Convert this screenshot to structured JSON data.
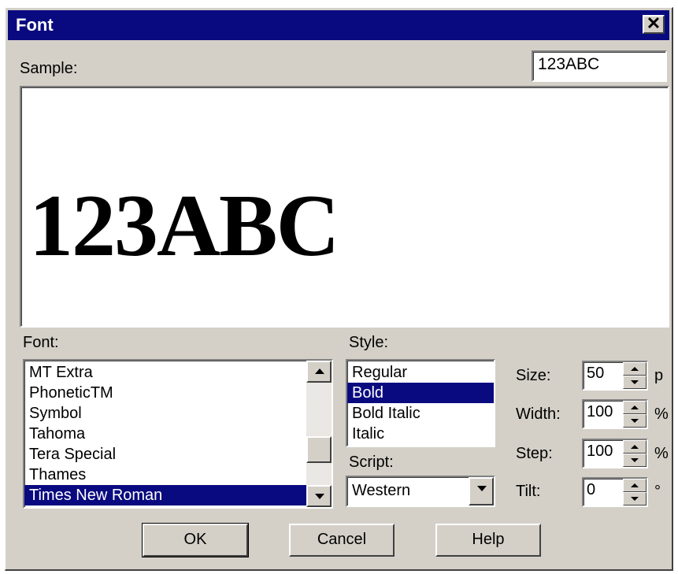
{
  "window": {
    "title": "Font",
    "close_symbol": "✕"
  },
  "sample": {
    "label": "Sample:",
    "input_value": "123ABC",
    "preview_text": "123ABC"
  },
  "font": {
    "label": "Font:",
    "items": [
      "MT Extra",
      "PhoneticTM",
      "Symbol",
      "Tahoma",
      "Tera Special",
      "Thames",
      "Times New Roman"
    ],
    "selected": "Times New Roman"
  },
  "style": {
    "label": "Style:",
    "items": [
      "Regular",
      "Bold",
      "Bold Italic",
      "Italic"
    ],
    "selected": "Bold"
  },
  "script": {
    "label": "Script:",
    "value": "Western"
  },
  "size": {
    "label": "Size:",
    "value": "50",
    "unit": "p"
  },
  "width": {
    "label": "Width:",
    "value": "100",
    "unit": "%"
  },
  "step": {
    "label": "Step:",
    "value": "100",
    "unit": "%"
  },
  "tilt": {
    "label": "Tilt:",
    "value": "0",
    "unit": "°"
  },
  "buttons": {
    "ok": "OK",
    "cancel": "Cancel",
    "help": "Help"
  },
  "colors": {
    "titlebar": "#0a0a80",
    "face": "#d4d0c8",
    "selection": "#0a0a80"
  }
}
